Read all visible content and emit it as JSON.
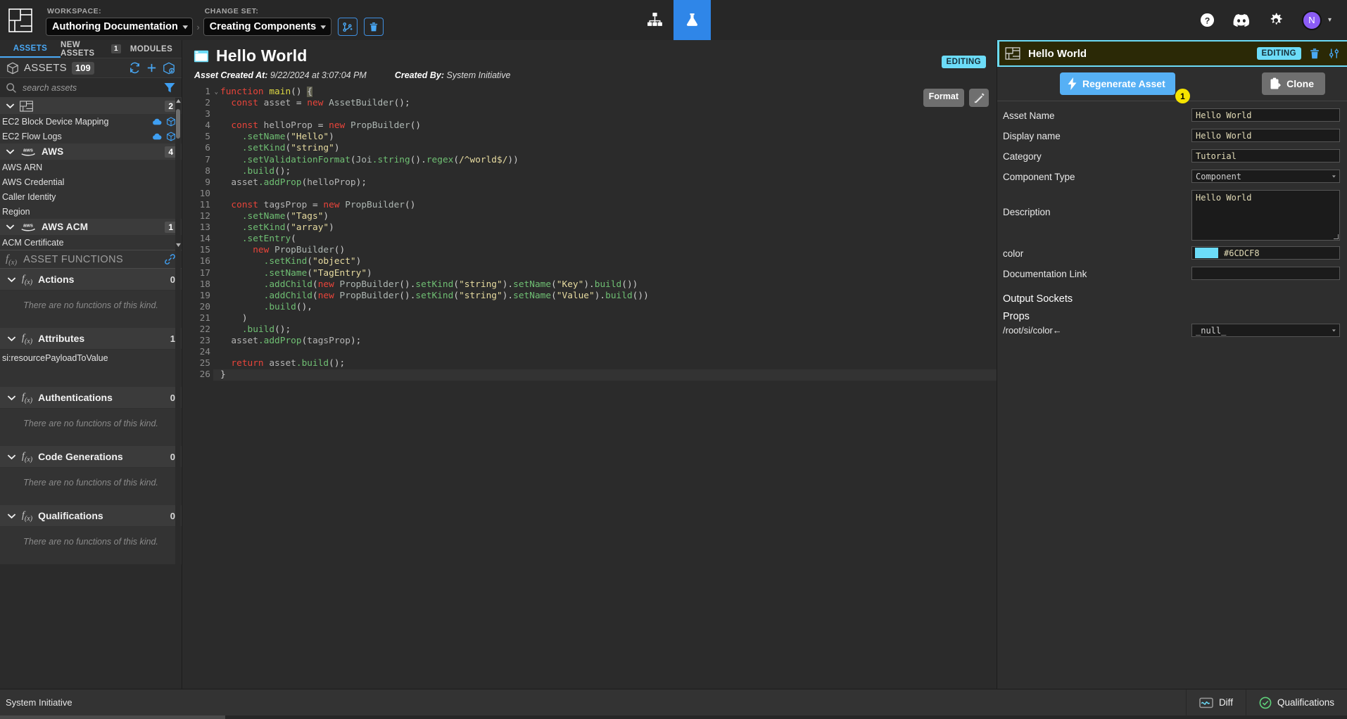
{
  "topbar": {
    "workspace_label": "WORKSPACE:",
    "workspace_value": "Authoring Documentation",
    "changeset_label": "CHANGE SET:",
    "changeset_value": "Creating Components",
    "crumb_separator": "›",
    "merge_icon": "git-merge-icon",
    "trash_icon": "trash-icon",
    "center_tabs": [
      {
        "name": "tab-model",
        "icon": "sitemap-icon",
        "active": false
      },
      {
        "name": "tab-lab",
        "icon": "flask-icon",
        "active": true
      }
    ],
    "help_icon": "question-circle-icon",
    "discord_icon": "discord-icon",
    "settings_icon": "gear-icon",
    "avatar_initial": "N",
    "avatar_color": "#8b5cf6",
    "profile_chevron": "chevron-down-icon"
  },
  "sidebar": {
    "tabs": [
      {
        "label": "ASSETS",
        "badge": "",
        "active": true
      },
      {
        "label": "NEW ASSETS",
        "badge": "1",
        "active": false
      },
      {
        "label": "MODULES",
        "badge": "",
        "active": false
      }
    ],
    "header": {
      "icon": "cube-icon",
      "title": "ASSETS",
      "count": "109",
      "refresh_icon": "refresh-icon",
      "add_icon": "plus-icon",
      "export_icon": "cube-download-icon"
    },
    "search": {
      "placeholder": "search assets",
      "value": "",
      "icon": "search-icon",
      "filter_icon": "funnel-icon"
    },
    "tree": [
      {
        "type": "group",
        "name": "",
        "icon": "asset-frame-icon",
        "count": "2",
        "children": [
          {
            "label": "EC2 Block Device Mapping",
            "icons": [
              "cloud-upload-icon",
              "cube-sync-icon"
            ]
          },
          {
            "label": "EC2 Flow Logs",
            "icons": [
              "cloud-upload-icon",
              "cube-sync-icon"
            ]
          }
        ]
      },
      {
        "type": "group",
        "name": "AWS",
        "icon": "aws-logo-icon",
        "count": "4",
        "children": [
          {
            "label": "AWS ARN",
            "icons": []
          },
          {
            "label": "AWS Credential",
            "icons": []
          },
          {
            "label": "Caller Identity",
            "icons": []
          },
          {
            "label": "Region",
            "icons": []
          }
        ]
      },
      {
        "type": "group",
        "name": "AWS ACM",
        "icon": "aws-logo-icon",
        "count": "1",
        "children": [
          {
            "label": "ACM Certificate",
            "icons": []
          }
        ]
      }
    ],
    "functions_section": {
      "title": "ASSET FUNCTIONS",
      "icon": "fx-icon",
      "link_icon": "link-icon",
      "empty_text": "There are no functions of this kind.",
      "groups": [
        {
          "label": "Actions",
          "count": "0",
          "items": []
        },
        {
          "label": "Attributes",
          "count": "1",
          "items": [
            "si:resourcePayloadToValue"
          ]
        },
        {
          "label": "Authentications",
          "count": "0",
          "items": []
        },
        {
          "label": "Code Generations",
          "count": "0",
          "items": []
        },
        {
          "label": "Qualifications",
          "count": "0",
          "items": []
        }
      ]
    }
  },
  "editor": {
    "asset_icon": "asset-frame-icon",
    "asset_title": "Hello World",
    "created_at_label": "Asset Created At:",
    "created_at_value": "9/22/2024 at 3:07:04 PM",
    "created_by_label": "Created By:",
    "created_by_value": "System Initiative",
    "editing_badge": "EDITING",
    "format_button": "Format",
    "pencil_icon": "edit-pencil-icon",
    "fold_icon": "chevron-down-icon",
    "total_lines": 26,
    "current_line": 26,
    "lines": [
      [
        {
          "t": "function ",
          "c": "kw"
        },
        {
          "t": "main",
          "c": "fn"
        },
        {
          "t": "() ",
          "c": "pun"
        },
        {
          "t": "{",
          "c": "cursor"
        }
      ],
      [
        {
          "t": "  const ",
          "c": "kw"
        },
        {
          "t": "asset ",
          "c": "id"
        },
        {
          "t": "= ",
          "c": "pun"
        },
        {
          "t": "new ",
          "c": "kw"
        },
        {
          "t": "AssetBuilder",
          "c": "cls"
        },
        {
          "t": "();",
          "c": "pun"
        }
      ],
      [],
      [
        {
          "t": "  const ",
          "c": "kw"
        },
        {
          "t": "helloProp ",
          "c": "id"
        },
        {
          "t": "= ",
          "c": "pun"
        },
        {
          "t": "new ",
          "c": "kw"
        },
        {
          "t": "PropBuilder",
          "c": "cls"
        },
        {
          "t": "()",
          "c": "pun"
        }
      ],
      [
        {
          "t": "    ",
          "c": "pun"
        },
        {
          "t": ".setName",
          "c": "mth"
        },
        {
          "t": "(",
          "c": "pun"
        },
        {
          "t": "\"Hello\"",
          "c": "str"
        },
        {
          "t": ")",
          "c": "pun"
        }
      ],
      [
        {
          "t": "    ",
          "c": "pun"
        },
        {
          "t": ".setKind",
          "c": "mth"
        },
        {
          "t": "(",
          "c": "pun"
        },
        {
          "t": "\"string\"",
          "c": "str"
        },
        {
          "t": ")",
          "c": "pun"
        }
      ],
      [
        {
          "t": "    ",
          "c": "pun"
        },
        {
          "t": ".setValidationFormat",
          "c": "mth"
        },
        {
          "t": "(",
          "c": "pun"
        },
        {
          "t": "Joi",
          "c": "cls"
        },
        {
          "t": ".string",
          "c": "mth"
        },
        {
          "t": "().",
          "c": "pun"
        },
        {
          "t": "regex",
          "c": "mth"
        },
        {
          "t": "(",
          "c": "pun"
        },
        {
          "t": "/^world$/",
          "c": "str"
        },
        {
          "t": "))",
          "c": "pun"
        }
      ],
      [
        {
          "t": "    ",
          "c": "pun"
        },
        {
          "t": ".build",
          "c": "mth"
        },
        {
          "t": "();",
          "c": "pun"
        }
      ],
      [
        {
          "t": "  asset",
          "c": "id"
        },
        {
          "t": ".addProp",
          "c": "mth"
        },
        {
          "t": "(",
          "c": "pun"
        },
        {
          "t": "helloProp",
          "c": "id"
        },
        {
          "t": ");",
          "c": "pun"
        }
      ],
      [],
      [
        {
          "t": "  const ",
          "c": "kw"
        },
        {
          "t": "tagsProp ",
          "c": "id"
        },
        {
          "t": "= ",
          "c": "pun"
        },
        {
          "t": "new ",
          "c": "kw"
        },
        {
          "t": "PropBuilder",
          "c": "cls"
        },
        {
          "t": "()",
          "c": "pun"
        }
      ],
      [
        {
          "t": "    ",
          "c": "pun"
        },
        {
          "t": ".setName",
          "c": "mth"
        },
        {
          "t": "(",
          "c": "pun"
        },
        {
          "t": "\"Tags\"",
          "c": "str"
        },
        {
          "t": ")",
          "c": "pun"
        }
      ],
      [
        {
          "t": "    ",
          "c": "pun"
        },
        {
          "t": ".setKind",
          "c": "mth"
        },
        {
          "t": "(",
          "c": "pun"
        },
        {
          "t": "\"array\"",
          "c": "str"
        },
        {
          "t": ")",
          "c": "pun"
        }
      ],
      [
        {
          "t": "    ",
          "c": "pun"
        },
        {
          "t": ".setEntry",
          "c": "mth"
        },
        {
          "t": "(",
          "c": "pun"
        }
      ],
      [
        {
          "t": "      new ",
          "c": "kw"
        },
        {
          "t": "PropBuilder",
          "c": "cls"
        },
        {
          "t": "()",
          "c": "pun"
        }
      ],
      [
        {
          "t": "        ",
          "c": "pun"
        },
        {
          "t": ".setKind",
          "c": "mth"
        },
        {
          "t": "(",
          "c": "pun"
        },
        {
          "t": "\"object\"",
          "c": "str"
        },
        {
          "t": ")",
          "c": "pun"
        }
      ],
      [
        {
          "t": "        ",
          "c": "pun"
        },
        {
          "t": ".setName",
          "c": "mth"
        },
        {
          "t": "(",
          "c": "pun"
        },
        {
          "t": "\"TagEntry\"",
          "c": "str"
        },
        {
          "t": ")",
          "c": "pun"
        }
      ],
      [
        {
          "t": "        ",
          "c": "pun"
        },
        {
          "t": ".addChild",
          "c": "mth"
        },
        {
          "t": "(",
          "c": "pun"
        },
        {
          "t": "new ",
          "c": "kw"
        },
        {
          "t": "PropBuilder",
          "c": "cls"
        },
        {
          "t": "().",
          "c": "pun"
        },
        {
          "t": "setKind",
          "c": "mth"
        },
        {
          "t": "(",
          "c": "pun"
        },
        {
          "t": "\"string\"",
          "c": "str"
        },
        {
          "t": ").",
          "c": "pun"
        },
        {
          "t": "setName",
          "c": "mth"
        },
        {
          "t": "(",
          "c": "pun"
        },
        {
          "t": "\"Key\"",
          "c": "str"
        },
        {
          "t": ").",
          "c": "pun"
        },
        {
          "t": "build",
          "c": "mth"
        },
        {
          "t": "())",
          "c": "pun"
        }
      ],
      [
        {
          "t": "        ",
          "c": "pun"
        },
        {
          "t": ".addChild",
          "c": "mth"
        },
        {
          "t": "(",
          "c": "pun"
        },
        {
          "t": "new ",
          "c": "kw"
        },
        {
          "t": "PropBuilder",
          "c": "cls"
        },
        {
          "t": "().",
          "c": "pun"
        },
        {
          "t": "setKind",
          "c": "mth"
        },
        {
          "t": "(",
          "c": "pun"
        },
        {
          "t": "\"string\"",
          "c": "str"
        },
        {
          "t": ").",
          "c": "pun"
        },
        {
          "t": "setName",
          "c": "mth"
        },
        {
          "t": "(",
          "c": "pun"
        },
        {
          "t": "\"Value\"",
          "c": "str"
        },
        {
          "t": ").",
          "c": "pun"
        },
        {
          "t": "build",
          "c": "mth"
        },
        {
          "t": "())",
          "c": "pun"
        }
      ],
      [
        {
          "t": "        ",
          "c": "pun"
        },
        {
          "t": ".build",
          "c": "mth"
        },
        {
          "t": "(),",
          "c": "pun"
        }
      ],
      [
        {
          "t": "    )",
          "c": "pun"
        }
      ],
      [
        {
          "t": "    ",
          "c": "pun"
        },
        {
          "t": ".build",
          "c": "mth"
        },
        {
          "t": "();",
          "c": "pun"
        }
      ],
      [
        {
          "t": "  asset",
          "c": "id"
        },
        {
          "t": ".addProp",
          "c": "mth"
        },
        {
          "t": "(",
          "c": "pun"
        },
        {
          "t": "tagsProp",
          "c": "id"
        },
        {
          "t": ");",
          "c": "pun"
        }
      ],
      [],
      [
        {
          "t": "  return ",
          "c": "kw"
        },
        {
          "t": "asset",
          "c": "id"
        },
        {
          "t": ".build",
          "c": "mth"
        },
        {
          "t": "();",
          "c": "pun"
        }
      ],
      [
        {
          "t": "}",
          "c": "pun"
        }
      ]
    ]
  },
  "right_panel": {
    "header": {
      "icon": "asset-frame-icon",
      "title": "Hello World",
      "editing_badge": "EDITING",
      "trash_icon": "trash-icon",
      "sliders_icon": "sliders-icon",
      "accent_color": "#6CDCF8"
    },
    "actions": {
      "regenerate_label": "Regenerate Asset",
      "regenerate_icon": "lightning-bolt-icon",
      "regenerate_badge": "1",
      "clone_label": "Clone",
      "clone_icon": "clipboard-clone-icon"
    },
    "fields": [
      {
        "type": "text",
        "label": "Asset Name",
        "value": "Hello World"
      },
      {
        "type": "text",
        "label": "Display name",
        "value": "Hello World"
      },
      {
        "type": "text",
        "label": "Category",
        "value": "Tutorial"
      },
      {
        "type": "select",
        "label": "Component Type",
        "value": "Component"
      },
      {
        "type": "textarea",
        "label": "Description",
        "value": "Hello World"
      },
      {
        "type": "color",
        "label": "color",
        "value": "#6CDCF8"
      },
      {
        "type": "text",
        "label": "Documentation Link",
        "value": ""
      }
    ],
    "output_sockets_title": "Output Sockets",
    "props_title": "Props",
    "props": [
      {
        "label": "/root/si/color←",
        "value": "_null_"
      }
    ]
  },
  "bottom_bar": {
    "status_text": "System Initiative",
    "diff_label": "Diff",
    "diff_icon": "diff-icon",
    "qualifications_label": "Qualifications",
    "qualifications_icon": "check-circle-icon"
  }
}
